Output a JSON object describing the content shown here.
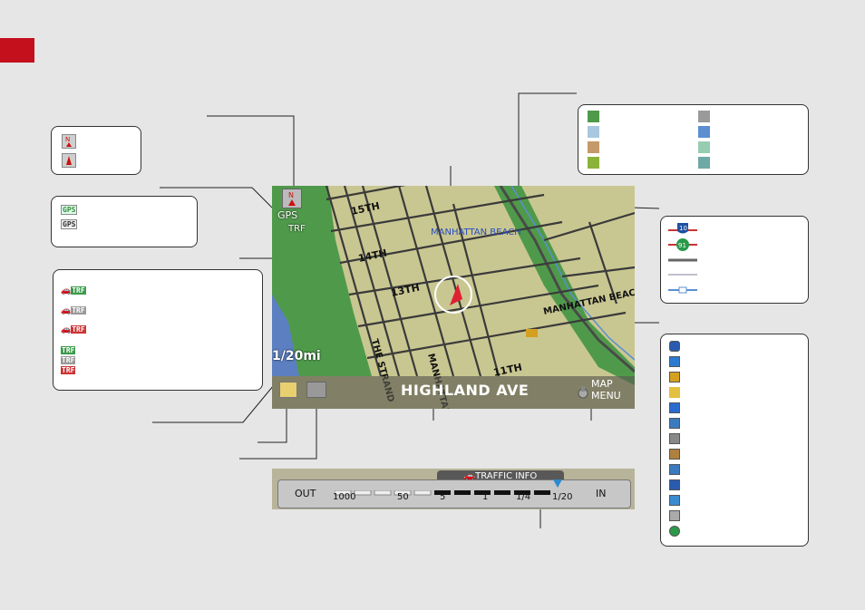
{
  "map": {
    "compass_label": "N",
    "gps_label": "GPS",
    "trf_label": "TRF",
    "streets": [
      "15TH",
      "14TH",
      "13TH",
      "11TH",
      "THE STRAND",
      "MANHATTAN"
    ],
    "city_label": "MANHATTAN BEACH",
    "beach_label": "MANHATTAN BEACH",
    "scale": "1/20mi",
    "street_name": "HIGHLAND AVE",
    "menu_line1": "MAP",
    "menu_line2": "MENU"
  },
  "traffic": {
    "title": "TRAFFIC INFO",
    "out": "OUT",
    "in": "IN",
    "ticks": [
      "1000",
      "50",
      "5",
      "1",
      "1/4",
      "1/20"
    ]
  },
  "legend_colors": [
    "#4f9a4a",
    "#9a9a9a",
    "#a9c8e0",
    "#5b8fd0",
    "#c49a6a",
    "#96cdb0",
    "#8bb33b",
    "#6fa9a5"
  ],
  "accent": "#c40f1d"
}
